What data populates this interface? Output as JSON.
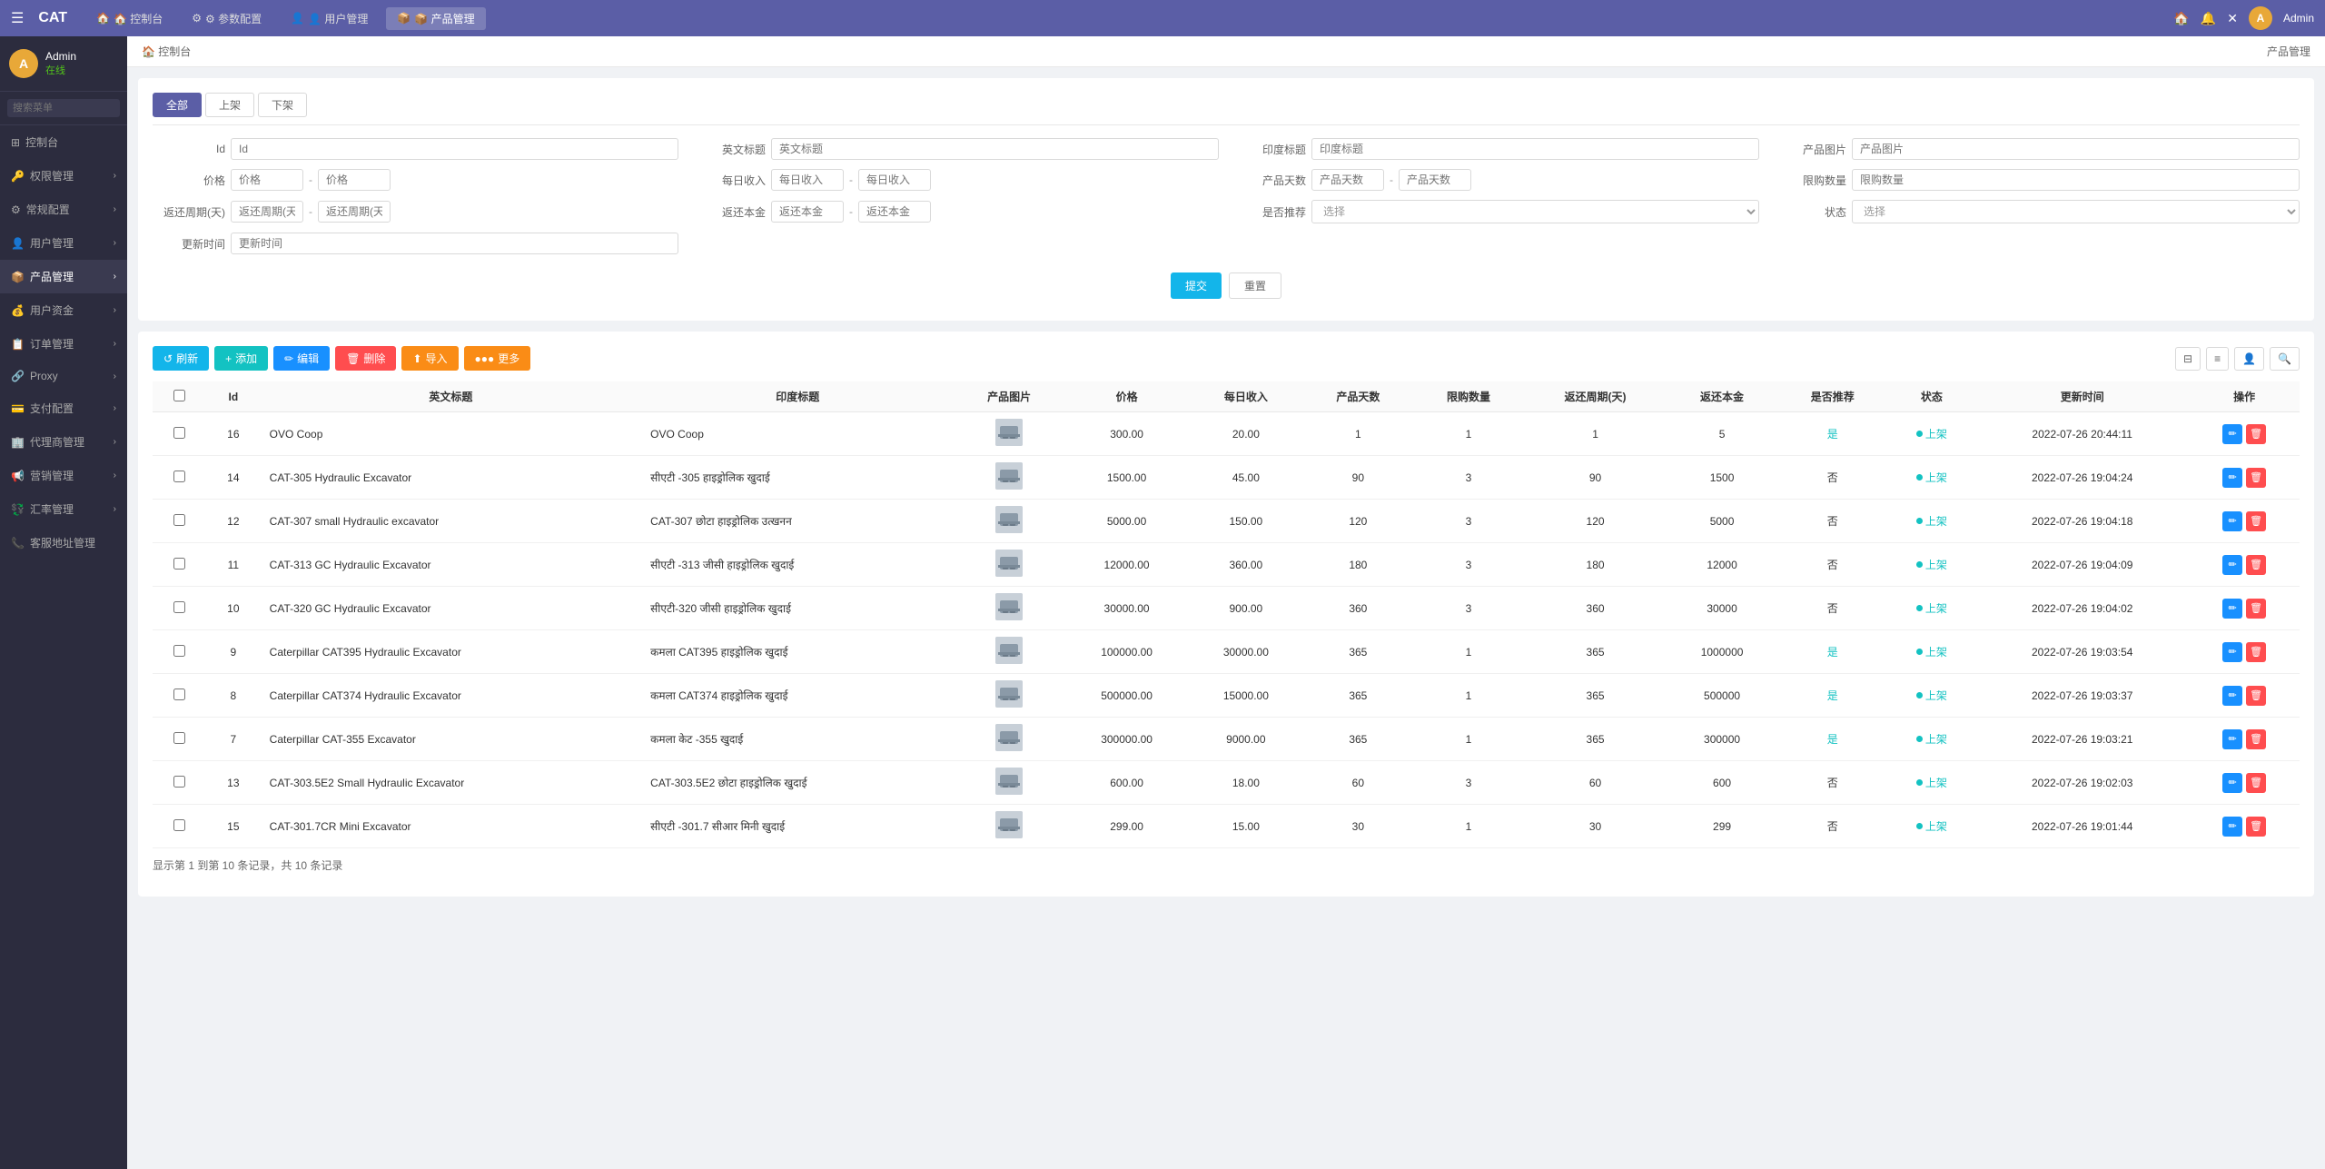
{
  "app": {
    "title": "CAT"
  },
  "topnav": {
    "hamburger": "☰",
    "items": [
      {
        "label": "🏠 控制台",
        "key": "dashboard"
      },
      {
        "label": "⚙ 参数配置",
        "key": "params"
      },
      {
        "label": "👤 用户管理",
        "key": "users"
      },
      {
        "label": "📦 产品管理",
        "key": "products",
        "active": true
      }
    ],
    "right": {
      "home_icon": "🏠",
      "notif_icon": "🔔",
      "close_icon": "✕",
      "username": "Admin"
    }
  },
  "sidebar": {
    "user": {
      "avatar_letter": "A",
      "name": "Admin",
      "status": "在线"
    },
    "search_placeholder": "搜索菜单",
    "items": [
      {
        "label": "控制台",
        "icon": "⊞",
        "key": "dashboard"
      },
      {
        "label": "权限管理",
        "icon": "🔑",
        "key": "auth",
        "arrow": true
      },
      {
        "label": "常规配置",
        "icon": "⚙",
        "key": "config",
        "arrow": true
      },
      {
        "label": "用户管理",
        "icon": "👤",
        "key": "users",
        "arrow": true
      },
      {
        "label": "产品管理",
        "icon": "📦",
        "key": "products",
        "active": true,
        "arrow": true
      },
      {
        "label": "用户资金",
        "icon": "💰",
        "key": "funds",
        "arrow": true
      },
      {
        "label": "订单管理",
        "icon": "📋",
        "key": "orders",
        "arrow": true
      },
      {
        "label": "Proxy",
        "icon": "🔗",
        "key": "proxy",
        "arrow": true
      },
      {
        "label": "支付配置",
        "icon": "💳",
        "key": "payment",
        "arrow": true
      },
      {
        "label": "代理商管理",
        "icon": "🏢",
        "key": "agent",
        "arrow": true
      },
      {
        "label": "营销管理",
        "icon": "📢",
        "key": "marketing",
        "arrow": true
      },
      {
        "label": "汇率管理",
        "icon": "💱",
        "key": "exchange",
        "arrow": true
      },
      {
        "label": "客服地址管理",
        "icon": "📞",
        "key": "support"
      }
    ]
  },
  "breadcrumb": {
    "home": "🏠 控制台",
    "page": "产品管理"
  },
  "filters": {
    "tabs": [
      {
        "label": "全部",
        "active": true
      },
      {
        "label": "上架"
      },
      {
        "label": "下架"
      }
    ],
    "fields": {
      "id_label": "Id",
      "id_placeholder": "Id",
      "english_title_label": "英文标题",
      "english_title_placeholder": "英文标题",
      "hindi_title_label": "印度标题",
      "hindi_title_placeholder": "印度标题",
      "product_image_label": "产品图片",
      "product_image_placeholder": "产品图片",
      "price_label": "价格",
      "price_from_placeholder": "价格",
      "price_to_placeholder": "价格",
      "daily_income_label": "每日收入",
      "daily_income_from_placeholder": "每日收入",
      "daily_income_to_placeholder": "每日收入",
      "product_days_label": "产品天数",
      "product_days_from_placeholder": "产品天数",
      "product_days_to_placeholder": "产品天数",
      "limit_qty_label": "限购数量",
      "limit_qty_placeholder": "限购数量",
      "refund_period_label": "返还周期(天)",
      "refund_period_from_placeholder": "返还周期(天)",
      "refund_period_to_placeholder": "返还周期(天)",
      "refund_amount_label": "返还本金",
      "refund_amount_from_placeholder": "返还本金",
      "refund_amount_to_placeholder": "返还本金",
      "recommend_label": "是否推荐",
      "recommend_placeholder": "选择",
      "status_label": "状态",
      "status_placeholder": "选择",
      "update_time_label": "更新时间",
      "update_time_placeholder": "更新时间"
    },
    "submit_label": "提交",
    "reset_label": "重置"
  },
  "toolbar": {
    "refresh_label": "刷新",
    "add_label": "添加",
    "edit_label": "编辑",
    "delete_label": "删除",
    "import_label": "导入",
    "more_label": "更多"
  },
  "table": {
    "columns": [
      "Id",
      "英文标题",
      "印度标题",
      "产品图片",
      "价格",
      "每日收入",
      "产品天数",
      "限购数量",
      "返还周期(天)",
      "返还本金",
      "是否推荐",
      "状态",
      "更新时间",
      "操作"
    ],
    "rows": [
      {
        "id": 16,
        "en_title": "OVO Coop",
        "hi_title": "OVO Coop",
        "price": "300.00",
        "daily_income": "20.00",
        "days": 1,
        "limit": 1,
        "refund_period": 1,
        "refund_amount": 5,
        "recommend": "是",
        "status": "上架",
        "update_time": "2022-07-26 20:44:11"
      },
      {
        "id": 14,
        "en_title": "CAT-305 Hydraulic Excavator",
        "hi_title": "सीएटी -305 हाइड्रोलिक खुदाई",
        "price": "1500.00",
        "daily_income": "45.00",
        "days": 90,
        "limit": 3,
        "refund_period": 90,
        "refund_amount": 1500,
        "recommend": "否",
        "status": "上架",
        "update_time": "2022-07-26 19:04:24"
      },
      {
        "id": 12,
        "en_title": "CAT-307 small Hydraulic excavator",
        "hi_title": "CAT-307 छोटा हाइड्रोलिक उत्खनन",
        "price": "5000.00",
        "daily_income": "150.00",
        "days": 120,
        "limit": 3,
        "refund_period": 120,
        "refund_amount": 5000,
        "recommend": "否",
        "status": "上架",
        "update_time": "2022-07-26 19:04:18"
      },
      {
        "id": 11,
        "en_title": "CAT-313 GC Hydraulic Excavator",
        "hi_title": "सीएटी -313 जीसी हाइड्रोलिक खुदाई",
        "price": "12000.00",
        "daily_income": "360.00",
        "days": 180,
        "limit": 3,
        "refund_period": 180,
        "refund_amount": 12000,
        "recommend": "否",
        "status": "上架",
        "update_time": "2022-07-26 19:04:09"
      },
      {
        "id": 10,
        "en_title": "CAT-320 GC Hydraulic Excavator",
        "hi_title": "सीएटी-320 जीसी हाइड्रोलिक खुदाई",
        "price": "30000.00",
        "daily_income": "900.00",
        "days": 360,
        "limit": 3,
        "refund_period": 360,
        "refund_amount": 30000,
        "recommend": "否",
        "status": "上架",
        "update_time": "2022-07-26 19:04:02"
      },
      {
        "id": 9,
        "en_title": "Caterpillar CAT395 Hydraulic Excavator",
        "hi_title": "कमला CAT395 हाइड्रोलिक खुदाई",
        "price": "100000.00",
        "daily_income": "30000.00",
        "days": 365,
        "limit": 1,
        "refund_period": 365,
        "refund_amount": 1000000,
        "recommend": "是",
        "status": "上架",
        "update_time": "2022-07-26 19:03:54"
      },
      {
        "id": 8,
        "en_title": "Caterpillar CAT374 Hydraulic Excavator",
        "hi_title": "कमला CAT374 हाइड्रोलिक खुदाई",
        "price": "500000.00",
        "daily_income": "15000.00",
        "days": 365,
        "limit": 1,
        "refund_period": 365,
        "refund_amount": 500000,
        "recommend": "是",
        "status": "上架",
        "update_time": "2022-07-26 19:03:37"
      },
      {
        "id": 7,
        "en_title": "Caterpillar CAT-355 Excavator",
        "hi_title": "कमला केट -355 खुदाई",
        "price": "300000.00",
        "daily_income": "9000.00",
        "days": 365,
        "limit": 1,
        "refund_period": 365,
        "refund_amount": 300000,
        "recommend": "是",
        "status": "上架",
        "update_time": "2022-07-26 19:03:21"
      },
      {
        "id": 13,
        "en_title": "CAT-303.5E2 Small Hydraulic Excavator",
        "hi_title": "CAT-303.5E2 छोटा हाइड्रोलिक खुदाई",
        "price": "600.00",
        "daily_income": "18.00",
        "days": 60,
        "limit": 3,
        "refund_period": 60,
        "refund_amount": 600,
        "recommend": "否",
        "status": "上架",
        "update_time": "2022-07-26 19:02:03"
      },
      {
        "id": 15,
        "en_title": "CAT-301.7CR Mini Excavator",
        "hi_title": "सीएटी -301.7 सीआर मिनी खुदाई",
        "price": "299.00",
        "daily_income": "15.00",
        "days": 30,
        "limit": 1,
        "refund_period": 30,
        "refund_amount": 299,
        "recommend": "否",
        "status": "上架",
        "update_time": "2022-07-26 19:01:44"
      }
    ],
    "pagination_text": "显示第 1 到第 10 条记录，共 10 条记录"
  }
}
